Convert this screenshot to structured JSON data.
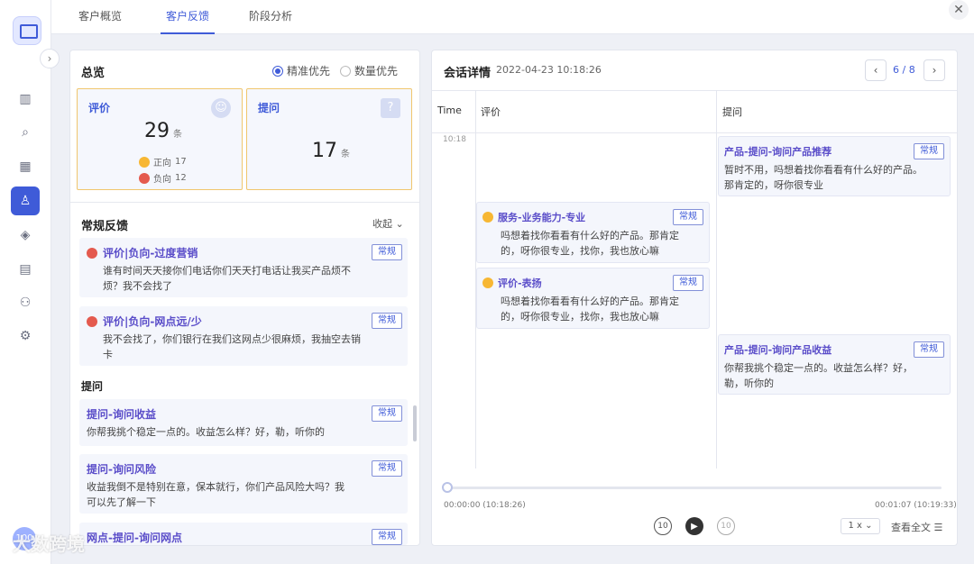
{
  "tabs": [
    "客户概览",
    "客户反馈",
    "阶段分析"
  ],
  "left": {
    "overview_title": "总览",
    "radio_precise": "精准优先",
    "radio_count": "数量优先",
    "eval": {
      "label": "评价",
      "count": "29",
      "unit": "条",
      "pos_label": "正向",
      "pos": "17",
      "neg_label": "负向",
      "neg": "12"
    },
    "question": {
      "label": "提问",
      "count": "17",
      "unit": "条"
    },
    "regular_title": "常规反馈",
    "collapse": "收起",
    "items": [
      {
        "title": "评价|负向-过度营销",
        "text": "谁有时间天天接你们电话你们天天打电话让我买产品烦不烦？我不会找了",
        "tag": "常规"
      },
      {
        "title": "评价|负向-网点远/少",
        "text": "我不会找了，你们银行在我们这网点少很麻烦，我抽空去销卡",
        "tag": "常规"
      }
    ],
    "question_title": "提问",
    "qitems": [
      {
        "title": "提问-询问收益",
        "text": "你帮我挑个稳定一点的。收益怎么样？好，勒，听你的",
        "tag": "常规"
      },
      {
        "title": "提问-询问风险",
        "text": "收益我倒不是特别在意，保本就行，你们产品风险大吗？我可以先了解一下",
        "tag": "常规"
      },
      {
        "title": "网点-提问-询问网点",
        "tag": "常规"
      }
    ]
  },
  "right": {
    "title": "会话详情",
    "datetime": "2022-04-23 10:18:26",
    "page": "6 / 8",
    "col_time": "Time",
    "col_eval": "评价",
    "col_q": "提问",
    "time_label": "10:18",
    "cards": [
      {
        "title": "产品-提问-询问产品推荐",
        "text": "暂时不用，吗想着找你看看有什么好的产品。那肯定的，呀你很专业",
        "tag": "常规"
      },
      {
        "title": "服务-业务能力-专业",
        "text": "吗想着找你看看有什么好的产品。那肯定的，呀你很专业，找你，我也放心嘛",
        "tag": "常规"
      },
      {
        "title": "评价-表扬",
        "text": "吗想着找你看看有什么好的产品。那肯定的，呀你很专业，找你，我也放心嘛",
        "tag": "常规"
      },
      {
        "title": "产品-提问-询问产品收益",
        "text": "你帮我挑个稳定一点的。收益怎么样？好，勒，听你的",
        "tag": "常规"
      }
    ],
    "start_time": "00:00:00 (10:18:26)",
    "end_time": "00:01:07 (10:19:33)",
    "speed": "1 x",
    "view_full": "查看全文"
  },
  "avatar_text": "100",
  "watermark": "大数跨境",
  "icons": [
    "chart-icon",
    "search-doc-icon",
    "calendar-icon",
    "user-icon",
    "layers-icon",
    "report-icon",
    "flow-icon",
    "settings-icon"
  ]
}
